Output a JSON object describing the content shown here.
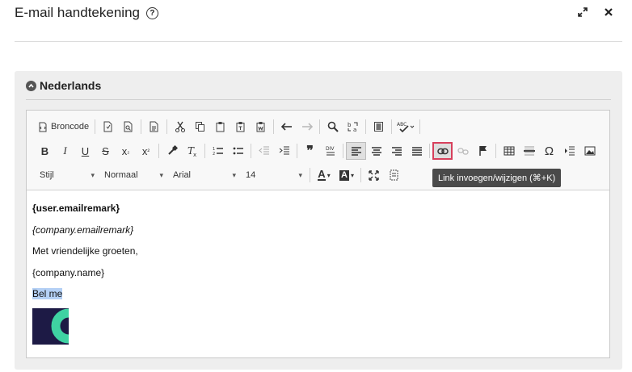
{
  "header": {
    "title": "E-mail handtekening",
    "help_icon": "?",
    "expand_icon": "expand-icon",
    "close_icon": "close-icon"
  },
  "panel": {
    "title": "Nederlands",
    "collapse_icon": "chevron-up-icon"
  },
  "toolbar": {
    "source_label": "Broncode",
    "combos": {
      "style": "Stijl",
      "format": "Normaal",
      "font": "Arial",
      "size": "14"
    },
    "text_buttons": {
      "bold": "B",
      "italic": "I",
      "underline": "U",
      "strike": "S",
      "subscript_base": "x",
      "subscript_mark": "₂",
      "superscript_base": "x",
      "superscript_mark": "²",
      "quote": "❞",
      "omega": "Ω",
      "text_color": "A",
      "bg_color": "A",
      "spell_abc": "ABC"
    },
    "tooltip": "Link invoegen/wijzigen (⌘+K)"
  },
  "content": {
    "line1": "{user.emailremark}",
    "line2": "{company.emailremark}",
    "line3": "Met vriendelijke groeten,",
    "line4": "{company.name}",
    "line5": "Bel me"
  },
  "colors": {
    "highlight_border": "#d7405c",
    "logo_bg": "#1d1a45",
    "logo_accent": "#3fd2a2",
    "selection": "#b4d0f5"
  }
}
